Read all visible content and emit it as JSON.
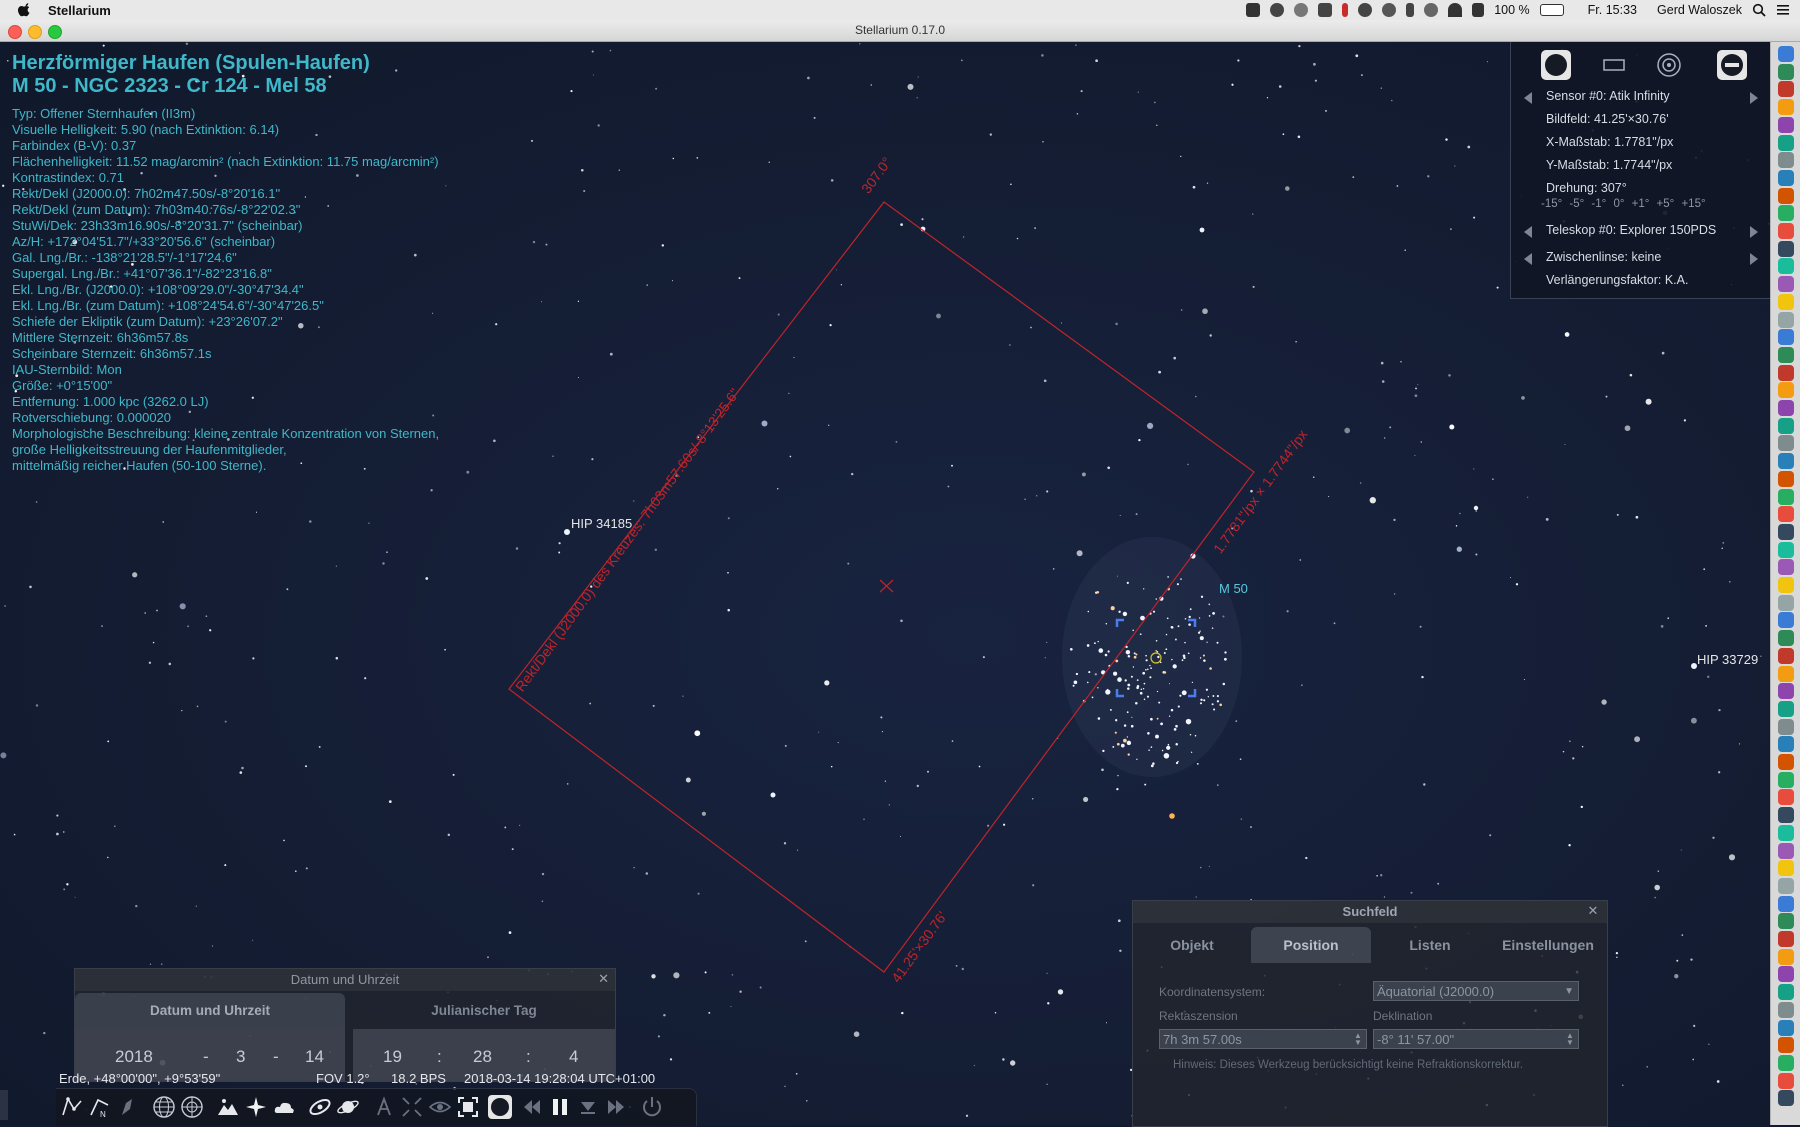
{
  "menubar": {
    "app_name": "Stellarium",
    "battery": "100 %",
    "clock": "Fr. 15:33",
    "user": "Gerd Waloszek"
  },
  "window": {
    "title": "Stellarium 0.17.0"
  },
  "object_info": {
    "title_line1": "Herzförmiger Haufen (Spulen-Haufen)",
    "title_line2": "M 50 - NGC 2323 - Cr 124 - Mel 58",
    "lines": [
      "Typ: Offener Sternhaufen (II3m)",
      "Visuelle Helligkeit: 5.90 (nach Extinktion: 6.14)",
      "Farbindex (B-V): 0.37",
      "Flächenhelligkeit: 11.52 mag/arcmin² (nach Extinktion: 11.75 mag/arcmin²)",
      "Kontrastindex: 0.71",
      "Rekt/Dekl (J2000.0): 7h02m47.50s/-8°20'16.1\"",
      "Rekt/Dekl (zum Datum): 7h03m40.76s/-8°22'02.3\"",
      "StuWi/Dek: 23h33m16.90s/-8°20'31.7\" (scheinbar)",
      "Az/H: +172°04'51.7\"/+33°20'56.6\" (scheinbar)",
      "Gal. Lng./Br.: -138°21'28.5\"/-1°17'24.6\"",
      "Supergal. Lng./Br.: +41°07'36.1\"/-82°23'16.8\"",
      "Ekl. Lng./Br. (J2000.0): +108°09'29.0\"/-30°47'34.4\"",
      "Ekl. Lng./Br. (zum Datum): +108°24'54.6\"/-30°47'26.5\"",
      "Schiefe der Ekliptik (zum Datum): +23°26'07.2\"",
      "Mittlere Sternzeit: 6h36m57.8s",
      "Scheinbare Sternzeit: 6h36m57.1s",
      "IAU-Sternbild: Mon",
      "Größe: +0°15'00\"",
      "Entfernung: 1.000 kpc (3262.0 LJ)",
      "Rotverschiebung: 0.000020",
      "Morphologische Beschreibung: kleine zentrale Konzentration von Sternen,",
      "große Helligkeitsstreuung der Haufenmitglieder,",
      "mittelmäßig reicher Haufen (50-100 Sterne)."
    ]
  },
  "sky_labels": {
    "hip_34185": "HIP 34185",
    "m50": "M 50",
    "hip_33729": "HIP 33729",
    "ccd_rotation": "307.0°",
    "ccd_center": "Rekt/Dekl (J2000.0) des Kreuzes: 7h03m57.60s/-8°13'25.6\"",
    "ccd_scale": "1.7781\"/px × 1.7744\"/px",
    "ccd_field": "41.25'×30.76'"
  },
  "ocular_panel": {
    "sensor": "Sensor #0: Atik Infinity",
    "bildfeld": "Bildfeld: 41.25'×30.76'",
    "x_scale": "X-Maßstab: 1.7781\"/px",
    "y_scale": "Y-Maßstab: 1.7744\"/px",
    "rotation": "Drehung: 307°",
    "rotation_buttons": "-15° -5° -1° 0° +1° +5° +15°",
    "telescope": "Teleskop #0: Explorer 150PDS",
    "lens": "Zwischenlinse: keine",
    "extension": "Verlängerungsfaktor: K.A."
  },
  "search_window": {
    "title": "Suchfeld",
    "tabs": [
      "Objekt",
      "Position",
      "Listen",
      "Einstellungen"
    ],
    "active_tab": "Position",
    "coord_label": "Koordinatensystem:",
    "coord_value": "Äquatorial (J2000.0)",
    "ra_label": "Rektaszension",
    "ra_value": "7h 3m 57.00s",
    "dec_label": "Deklination",
    "dec_value": "-8° 11' 57.00\"",
    "hint": "Hinweis: Dieses Werkzeug berücksichtigt keine Refraktionskorrektur."
  },
  "date_window": {
    "title": "Datum und Uhrzeit",
    "tabs": [
      "Datum und Uhrzeit",
      "Julianischer Tag"
    ],
    "year": "2018",
    "month": "3",
    "day": "14",
    "hour": "19",
    "minute": "28",
    "second": "4",
    "date_sep": "-",
    "time_sep": ":"
  },
  "status_bar": {
    "location": "Erde, +48°00'00\", +9°53'59\"",
    "fov": "FOV 1.2°",
    "fps": "18.2 BPS",
    "datetime": "2018-03-14 19:28:04 UTC+01:00"
  },
  "colors": {
    "info_text": "#3fb8c9",
    "ccd_frame": "#c0242b",
    "sky": "#141d33"
  }
}
